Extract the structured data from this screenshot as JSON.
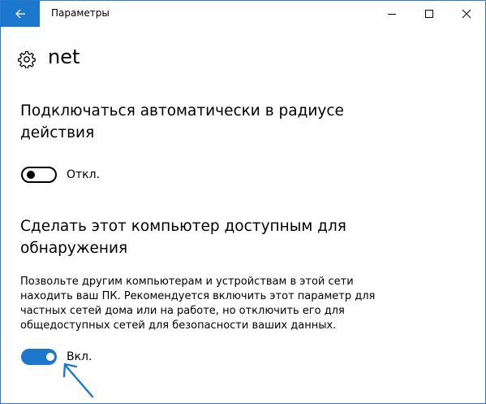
{
  "window": {
    "title": "Параметры",
    "accent_color": "#1d77cc"
  },
  "header": {
    "icon": "gear-icon",
    "title": "net"
  },
  "sections": [
    {
      "title_line1": "Подключаться автоматически в радиусе",
      "title_line2": "действия",
      "toggle_state": "off",
      "toggle_label": "Откл."
    },
    {
      "title_line1": "Сделать этот компьютер доступным для",
      "title_line2": "обнаружения",
      "description_lines": [
        "Позвольте другим компьютерам и устройствам в этой сети",
        "находить ваш ПК. Рекомендуется включить этот параметр для",
        "частных сетей дома или на работе, но отключить его для",
        "общедоступных сетей для безопасности ваших данных."
      ],
      "toggle_state": "on",
      "toggle_label": "Вкл."
    }
  ],
  "annotation": {
    "icon": "arrow-pointer-icon",
    "color": "#1d77cc"
  }
}
